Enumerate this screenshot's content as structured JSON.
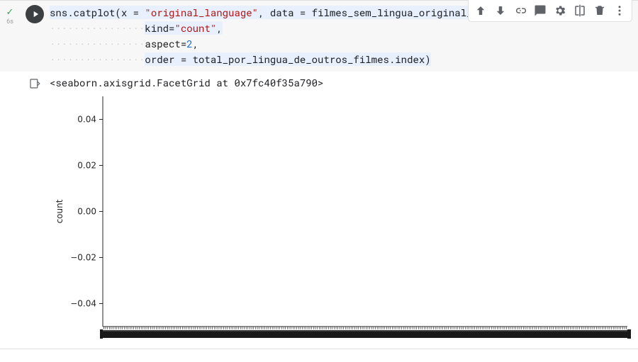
{
  "gutter": {
    "check": "✓",
    "runtime": "6s"
  },
  "toolbar": {
    "labels": {
      "up": "Move cell up",
      "down": "Move cell down",
      "link": "Copy link",
      "comment": "Add comment",
      "settings": "Settings",
      "mirror": "Mirror cell",
      "delete": "Delete cell",
      "more": "More"
    }
  },
  "code": {
    "line1": {
      "p1": "sns.catplot(x = ",
      "s1": "\"original_language\"",
      "p2": ", data = filmes_sem_lingua_original_em_ingles,"
    },
    "line2": {
      "indent": "················",
      "p1": "kind=",
      "s1": "\"count\"",
      "p2": ","
    },
    "line3": {
      "indent": "················",
      "p1": "aspect=",
      "n1": "2",
      "p2": ","
    },
    "line4": {
      "indent": "················",
      "p1": "order = total_por_lingua_de_outros_filmes.index)"
    }
  },
  "output": {
    "repr": "<seaborn.axisgrid.FacetGrid at 0x7fc40f35a790>"
  },
  "chart_data": {
    "type": "bar",
    "categories": [],
    "values": [],
    "title": "",
    "xlabel": "",
    "ylabel": "count",
    "ylim": [
      -0.05,
      0.05
    ],
    "yticks": [
      -0.04,
      -0.02,
      0.0,
      0.02,
      0.04
    ],
    "ytick_labels": [
      "−0.04",
      "−0.02",
      "0.00",
      "0.02",
      "0.04"
    ]
  }
}
